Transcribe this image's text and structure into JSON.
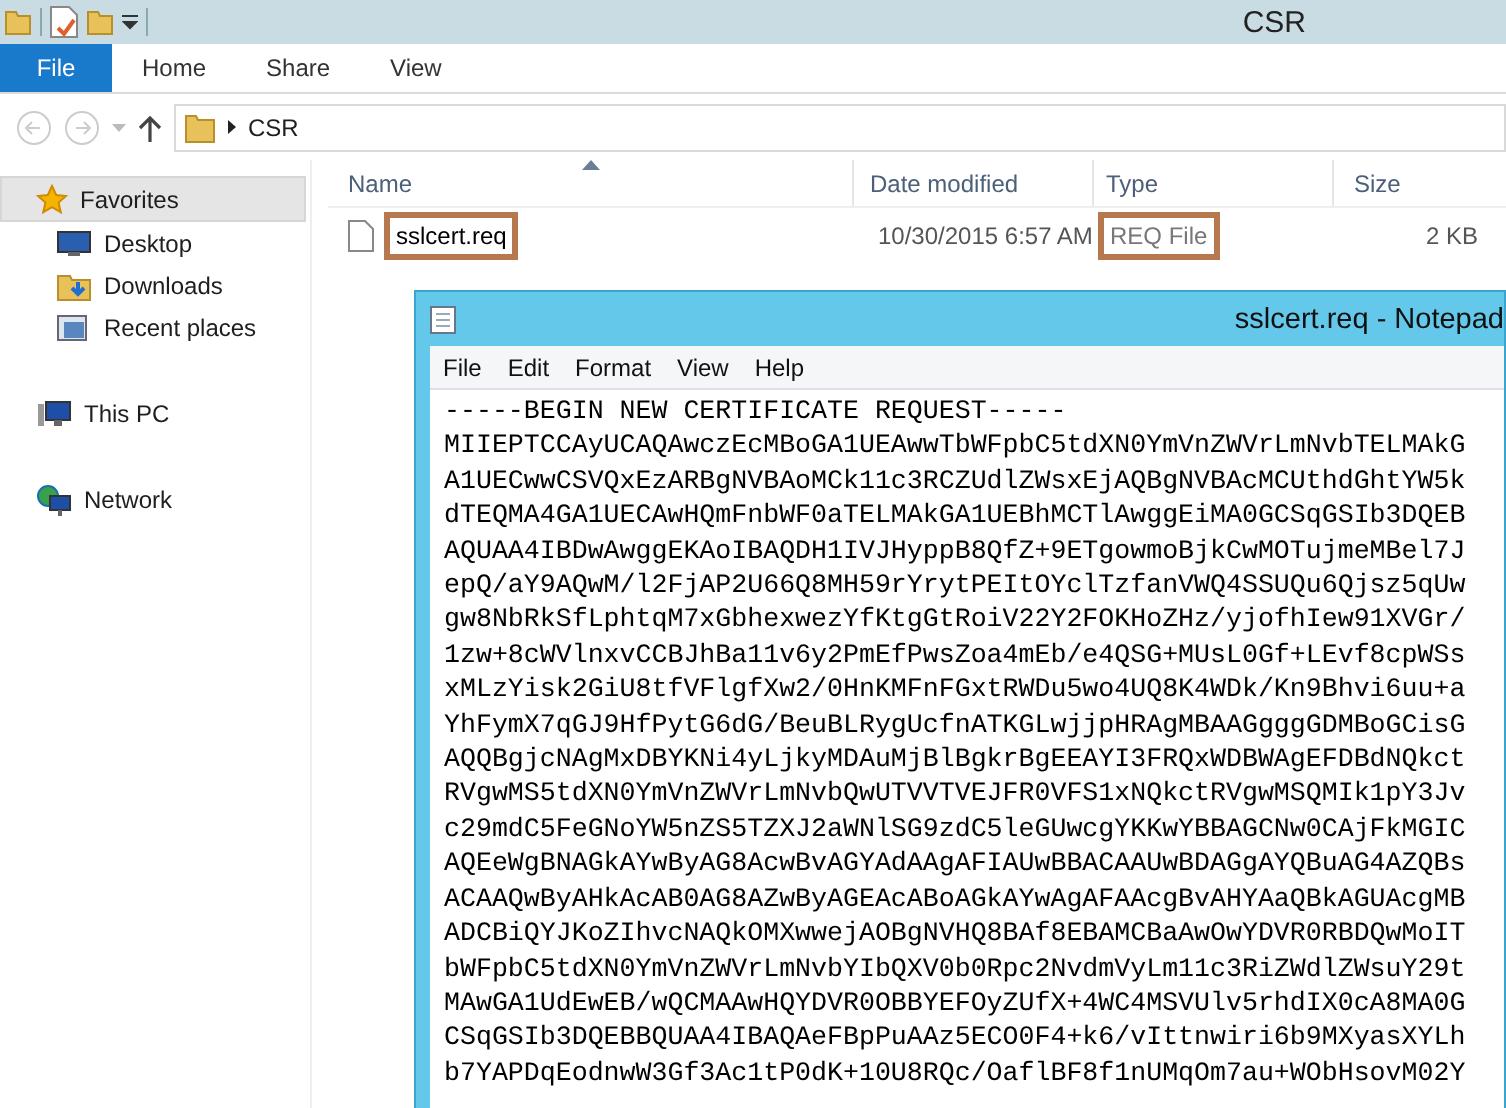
{
  "explorer": {
    "title": "CSR",
    "ribbon_tabs": [
      {
        "label": "File",
        "kind": "file"
      },
      {
        "label": "Home",
        "kind": "tab"
      },
      {
        "label": "Share",
        "kind": "tab"
      },
      {
        "label": "View",
        "kind": "tab"
      }
    ],
    "address": {
      "path": "CSR"
    },
    "sidebar": [
      {
        "label": "Favorites",
        "selected": true,
        "children": [
          {
            "label": "Desktop",
            "selected": false
          },
          {
            "label": "Downloads",
            "selected": false
          },
          {
            "label": "Recent places",
            "selected": false
          }
        ]
      },
      {
        "label": "This PC",
        "selected": false
      },
      {
        "label": "Network",
        "selected": false
      }
    ],
    "columns": [
      {
        "label": "Name",
        "sorted": true
      },
      {
        "label": "Date modified",
        "sorted": false
      },
      {
        "label": "Type",
        "sorted": false
      },
      {
        "label": "Size",
        "sorted": false
      }
    ],
    "rows": [
      {
        "cells": [
          {
            "text": "sslcert.req",
            "highlighted": true
          },
          {
            "text": "10/30/2015 6:57 AM",
            "highlighted": false
          },
          {
            "text": "REQ File",
            "highlighted": true
          },
          {
            "text": "2 KB",
            "highlighted": false
          }
        ]
      }
    ]
  },
  "notepad": {
    "title": "sslcert.req - Notepad",
    "menu": [
      "File",
      "Edit",
      "Format",
      "View",
      "Help"
    ],
    "lines": [
      "-----BEGIN NEW CERTIFICATE REQUEST-----",
      "MIIEPTCCAyUCAQAwczEcMBoGA1UEAwwTbWFpbC5tdXN0YmVnZWVrLmNvbTELMAkG",
      "A1UECwwCSVQxEzARBgNVBAoMCk11c3RCZUdlZWsxEjAQBgNVBAcMCUthdGhtYW5k",
      "dTEQMA4GA1UECAwHQmFnbWF0aTELMAkGA1UEBhMCTlAwggEiMA0GCSqGSIb3DQEB",
      "AQUAA4IBDwAwggEKAoIBAQDH1IVJHyppB8QfZ+9ETgowmoBjkCwMOTujmeMBel7J",
      "epQ/aY9AQwM/l2FjAP2U66Q8MH59rYrytPEItOYclTzfanVWQ4SSUQu6Qjsz5qUw",
      "gw8NbRkSfLphtqM7xGbhexwezYfKtgGtRoiV22Y2FOKHoZHz/yjofhIew91XVGr/",
      "1zw+8cWVlnxvCCBJhBa11v6y2PmEfPwsZoa4mEb/e4QSG+MUsL0Gf+LEvf8cpWSs",
      "xMLzYisk2GiU8tfVFlgfXw2/0HnKMFnFGxtRWDu5wo4UQ8K4WDk/Kn9Bhvi6uu+a",
      "YhFymX7qGJ9HfPytG6dG/BeuBLRygUcfnATKGLwjjpHRAgMBAAGgggGDMBoGCisG",
      "AQQBgjcNAgMxDBYKNi4yLjkyMDAuMjBlBgkrBgEEAYI3FRQxWDBWAgEFDBdNQkct",
      "RVgwMS5tdXN0YmVnZWVrLmNvbQwUTVVTVEJFR0VFS1xNQkctRVgwMSQMIk1pY3Jv",
      "c29mdC5FeGNoYW5nZS5TZXJ2aWNlSG9zdC5leGUwcgYKKwYBBAGCNw0CAjFkMGIC",
      "AQEeWgBNAGkAYwByAG8AcwBvAGYAdAAgAFIAUwBBACAAUwBDAGgAYQBuAG4AZQBs",
      "ACAAQwByAHkAcAB0AG8AZwByAGEAcABoAGkAYwAgAFAAcgBvAHYAaQBkAGUAcgMB",
      "ADCBiQYJKoZIhvcNAQkOMXwwejAOBgNVHQ8BAf8EBAMCBaAwOwYDVR0RBDQwMoIT",
      "bWFpbC5tdXN0YmVnZWVrLmNvbYIbQXV0b0Rpc2NvdmVyLm11c3RiZWdlZWsuY29t",
      "MAwGA1UdEwEB/wQCMAAwHQYDVR0OBBYEFOyZUfX+4WC4MSVUlv5rhdIX0cA8MA0G",
      "CSqGSIb3DQEBBQUAA4IBAQAeFBpPuAAz5ECO0F4+k6/vIttnwiri6b9MXyasXYLh",
      "b7YAPDqEodnwW3Gf3Ac1tP0dK+10U8RQc/OaflBF8f1nUMqOm7au+WObHsovM02Y"
    ]
  }
}
